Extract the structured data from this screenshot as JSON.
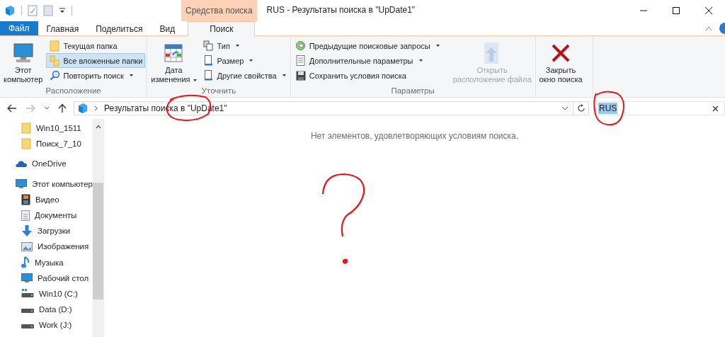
{
  "window": {
    "title": "RUS - Результаты поиска в \"UpDate1\"",
    "context_tab": "Средства поиска"
  },
  "tabs": [
    {
      "label": "Файл",
      "kind": "file",
      "selected": false
    },
    {
      "label": "Главная",
      "kind": "tab",
      "selected": false
    },
    {
      "label": "Поделиться",
      "kind": "tab",
      "selected": false
    },
    {
      "label": "Вид",
      "kind": "tab",
      "selected": false
    },
    {
      "label": "Поиск",
      "kind": "tab",
      "selected": true
    }
  ],
  "ribbon": {
    "groups": [
      {
        "label": "Расположение",
        "items": [
          {
            "label": "Этот\nкомпьютер",
            "kind": "large",
            "dropdown": false,
            "selected": false,
            "disabled": false
          },
          {
            "label": "Текущая папка",
            "kind": "small",
            "dropdown": false,
            "selected": false,
            "disabled": false
          },
          {
            "label": "Все вложенные папки",
            "kind": "small",
            "dropdown": false,
            "selected": true,
            "disabled": false
          },
          {
            "label": "Повторить поиск",
            "kind": "small",
            "dropdown": true,
            "selected": false,
            "disabled": false
          }
        ]
      },
      {
        "label": "Уточнить",
        "items": [
          {
            "label": "Дата\nизменения",
            "kind": "large",
            "dropdown": true,
            "selected": false,
            "disabled": false
          },
          {
            "label": "Тип",
            "kind": "small",
            "dropdown": true,
            "selected": false,
            "disabled": false
          },
          {
            "label": "Размер",
            "kind": "small",
            "dropdown": true,
            "selected": false,
            "disabled": false
          },
          {
            "label": "Другие свойства",
            "kind": "small",
            "dropdown": true,
            "selected": false,
            "disabled": false
          }
        ]
      },
      {
        "label": "Параметры",
        "items": [
          {
            "label": "Предыдущие поисковые запросы",
            "kind": "small",
            "dropdown": true,
            "selected": false,
            "disabled": false
          },
          {
            "label": "Дополнительные параметры",
            "kind": "small",
            "dropdown": true,
            "selected": false,
            "disabled": false
          },
          {
            "label": "Сохранить условия поиска",
            "kind": "small",
            "dropdown": false,
            "selected": false,
            "disabled": false
          },
          {
            "label": "Открыть\nрасположение файла",
            "kind": "large",
            "dropdown": false,
            "selected": false,
            "disabled": true
          }
        ]
      },
      {
        "items": [
          {
            "label": "Закрыть\nокно поиска",
            "kind": "large",
            "dropdown": false,
            "selected": false,
            "disabled": false
          }
        ]
      }
    ]
  },
  "address": {
    "path": "Результаты поиска в \"UpDate1\""
  },
  "search": {
    "value": "RUS",
    "selected": true
  },
  "sidebar": {
    "items": [
      {
        "label": "Win10_1511",
        "kind": "folder"
      },
      {
        "label": "Поиск_7_10",
        "kind": "folder"
      },
      {
        "label": "OneDrive",
        "kind": "cloud"
      },
      {
        "label": "Этот компьютер",
        "kind": "computer",
        "children": [
          {
            "label": "Видео",
            "kind": "video"
          },
          {
            "label": "Документы",
            "kind": "documents"
          },
          {
            "label": "Загрузки",
            "kind": "downloads"
          },
          {
            "label": "Изображения",
            "kind": "pictures"
          },
          {
            "label": "Музыка",
            "kind": "music"
          },
          {
            "label": "Рабочий стол",
            "kind": "desktop"
          },
          {
            "label": "Win10 (C:)",
            "kind": "system-drive"
          },
          {
            "label": "Data (D:)",
            "kind": "drive"
          },
          {
            "label": "Work (J:)",
            "kind": "drive"
          }
        ]
      }
    ]
  },
  "content": {
    "empty_message": "Нет элементов, удовлетворяющих условиям поиска."
  }
}
